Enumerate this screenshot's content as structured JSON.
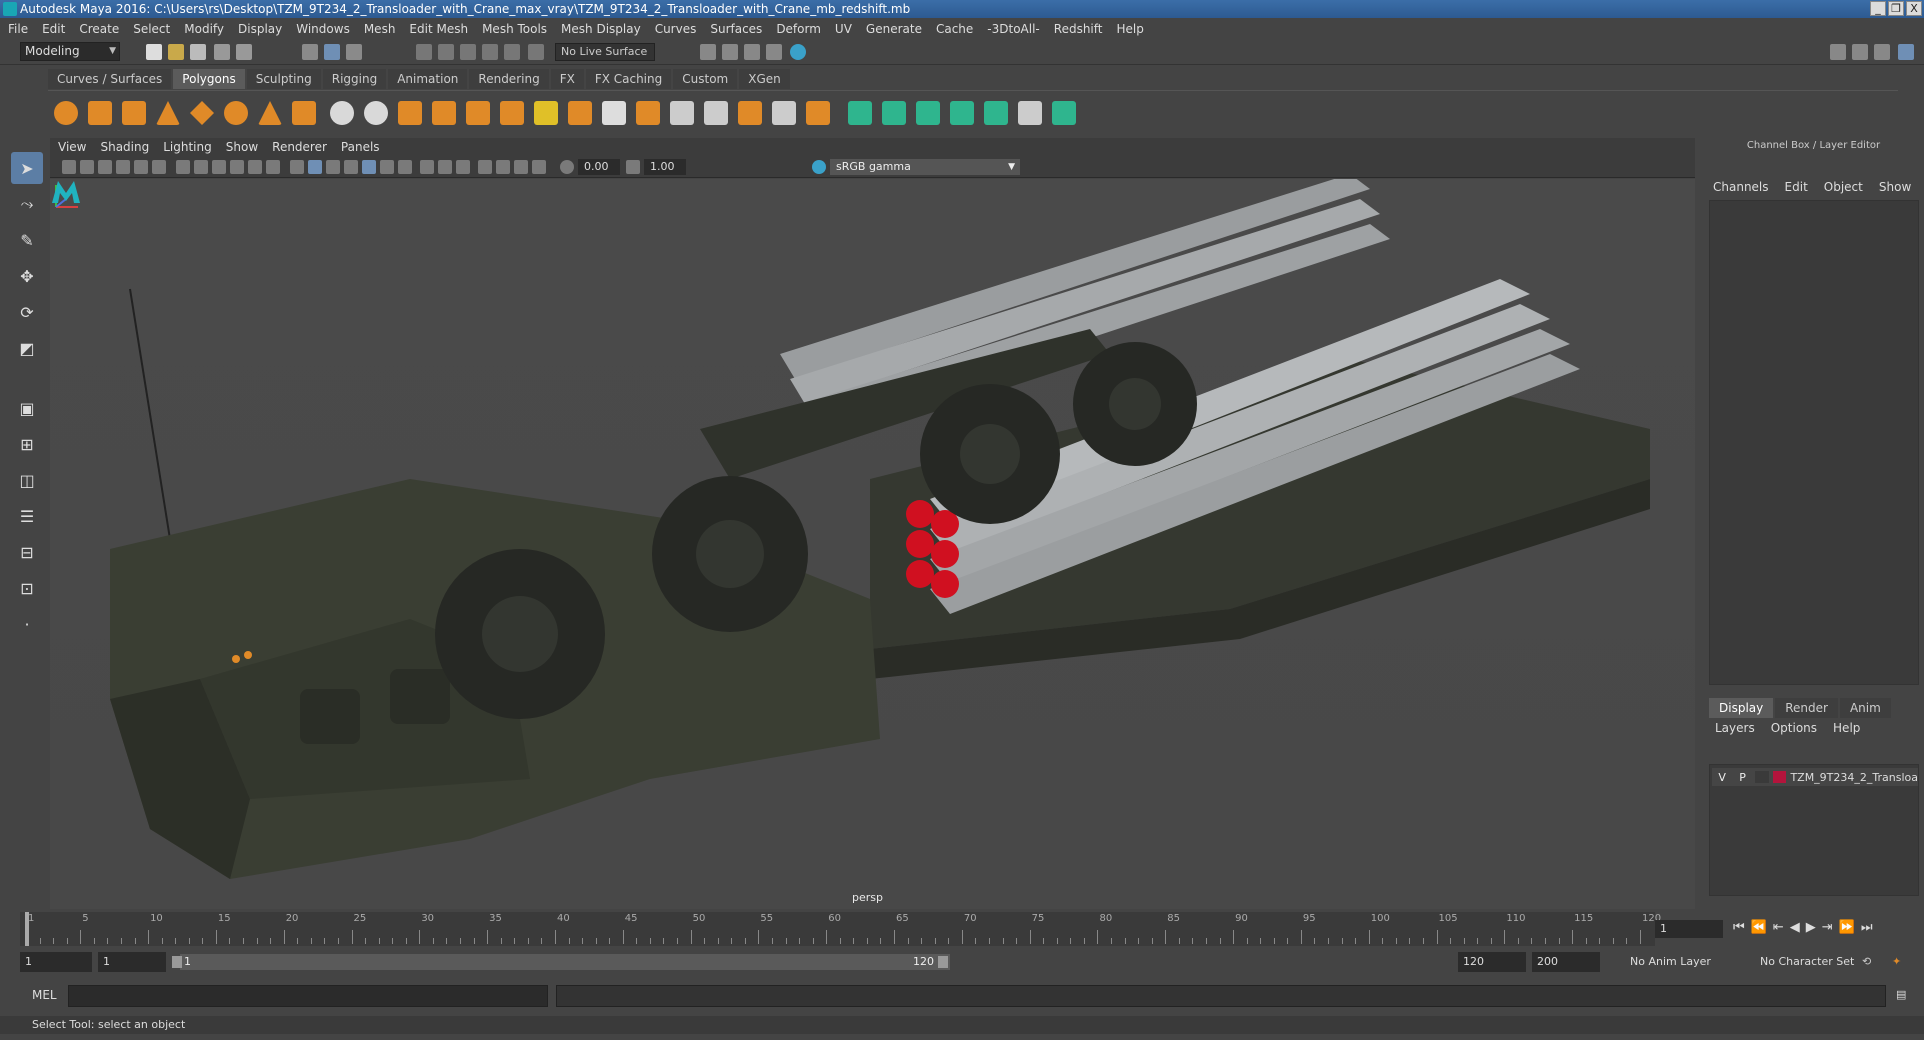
{
  "window": {
    "title": "Autodesk Maya 2016: C:\\Users\\rs\\Desktop\\TZM_9T234_2_Transloader_with_Crane_max_vray\\TZM_9T234_2_Transloader_with_Crane_mb_redshift.mb",
    "minimize": "_",
    "maximize": "❐",
    "close": "X"
  },
  "menubar": [
    "File",
    "Edit",
    "Create",
    "Select",
    "Modify",
    "Display",
    "Windows",
    "Mesh",
    "Edit Mesh",
    "Mesh Tools",
    "Mesh Display",
    "Curves",
    "Surfaces",
    "Deform",
    "UV",
    "Generate",
    "Cache",
    "-3DtoAll-",
    "Redshift",
    "Help"
  ],
  "statusline": {
    "mode": "Modeling",
    "live_surface": "No Live Surface"
  },
  "shelf_tabs": [
    "Curves / Surfaces",
    "Polygons",
    "Sculpting",
    "Rigging",
    "Animation",
    "Rendering",
    "FX",
    "FX Caching",
    "Custom",
    "XGen"
  ],
  "shelf_active": "Polygons",
  "viewport": {
    "menu": [
      "View",
      "Shading",
      "Lighting",
      "Show",
      "Renderer",
      "Panels"
    ],
    "exposure": "0.00",
    "gamma": "1.00",
    "color_space": "sRGB gamma",
    "camera": "persp"
  },
  "channelbox": {
    "title": "Channel Box / Layer Editor",
    "menu": [
      "Channels",
      "Edit",
      "Object",
      "Show"
    ],
    "tabs": [
      "Display",
      "Render",
      "Anim"
    ],
    "active_tab": "Display",
    "layer_menu": [
      "Layers",
      "Options",
      "Help"
    ],
    "layer": {
      "visible": "V",
      "playback": "P",
      "name": "TZM_9T234_2_Transloa",
      "color": "#b4143c"
    }
  },
  "timeline": {
    "labels": [
      "1",
      "5",
      "10",
      "15",
      "20",
      "25",
      "30",
      "35",
      "40",
      "45",
      "50",
      "55",
      "60",
      "65",
      "70",
      "75",
      "80",
      "85",
      "90",
      "95",
      "100",
      "105",
      "110",
      "115",
      "120"
    ],
    "current_frame": "1"
  },
  "range": {
    "start": "1",
    "playback_start": "1",
    "slider_start": "1",
    "slider_end": "120",
    "playback_end": "120",
    "end": "200",
    "anim_layer": "No Anim Layer",
    "character_set": "No Character Set"
  },
  "cmdline": {
    "label": "MEL"
  },
  "helpline": "Select Tool: select an object",
  "colors": {
    "accent": "#5c7ea5",
    "background": "#444444",
    "rocket_tip": "#d01020"
  }
}
